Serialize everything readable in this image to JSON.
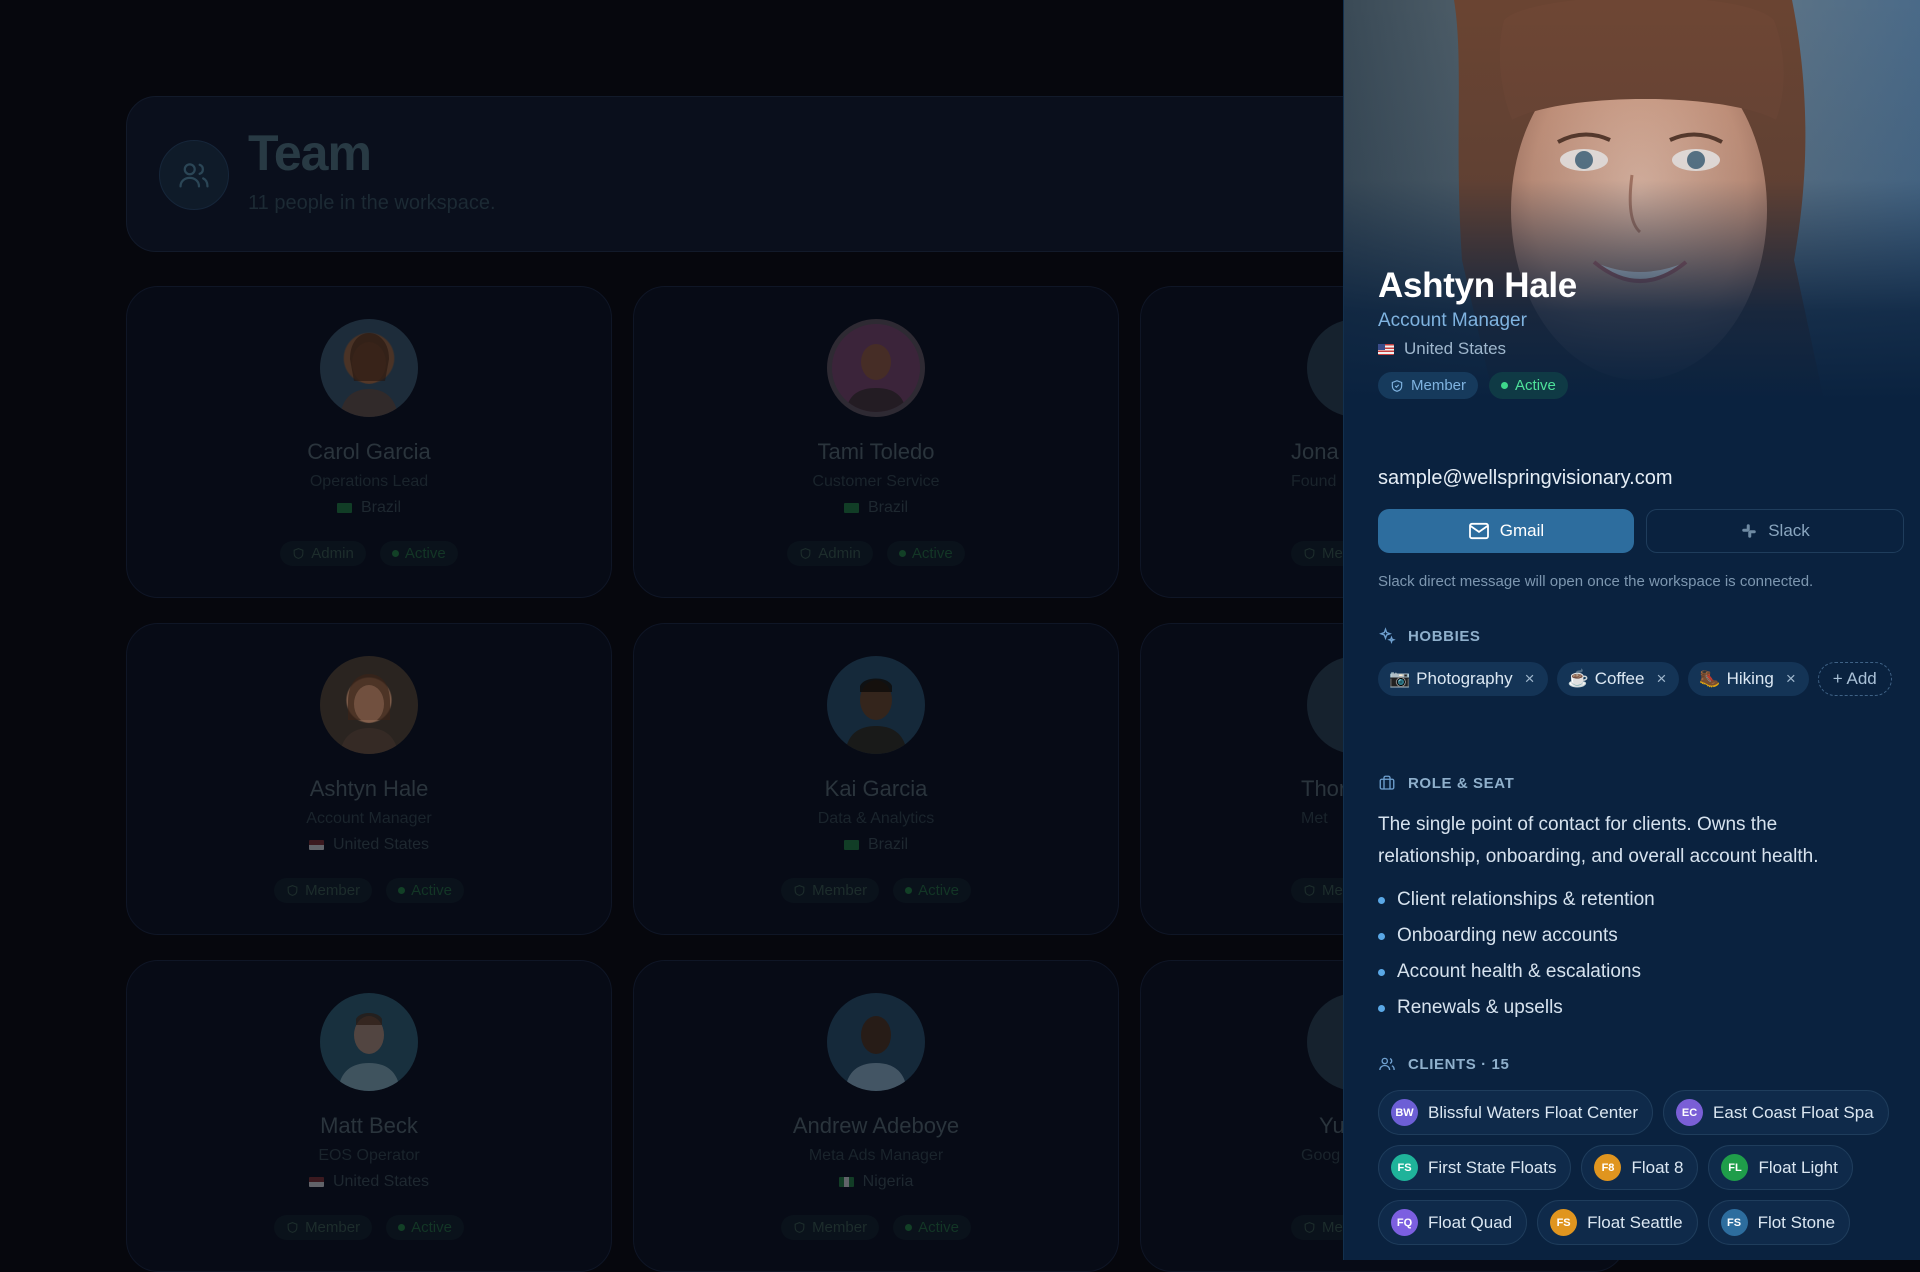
{
  "header": {
    "title": "Team",
    "subtitle": "11 people in the workspace."
  },
  "cards": [
    {
      "name": "Carol Garcia",
      "role": "Operations Lead",
      "country": "Brazil",
      "badge": "Admin",
      "status": "Active"
    },
    {
      "name": "Tami Toledo",
      "role": "Customer Service",
      "country": "Brazil",
      "badge": "Admin",
      "status": "Active"
    },
    {
      "name": "Jona",
      "role": "Found",
      "country": "",
      "badge": "Mer",
      "status": ""
    },
    {
      "name": "Ashtyn Hale",
      "role": "Account Manager",
      "country": "United States",
      "badge": "Member",
      "status": "Active"
    },
    {
      "name": "Kai Garcia",
      "role": "Data & Analytics",
      "country": "Brazil",
      "badge": "Member",
      "status": "Active"
    },
    {
      "name": "Thor",
      "role": "Met",
      "country": "",
      "badge": "Mer",
      "status": ""
    },
    {
      "name": "Matt Beck",
      "role": "EOS Operator",
      "country": "United States",
      "badge": "Member",
      "status": "Active"
    },
    {
      "name": "Andrew Adeboye",
      "role": "Meta Ads Manager",
      "country": "Nigeria",
      "badge": "Member",
      "status": "Active"
    },
    {
      "name": "Yu",
      "role": "Goog",
      "country": "",
      "badge": "Mer",
      "status": ""
    }
  ],
  "profile": {
    "name": "Ashtyn Hale",
    "role": "Account Manager",
    "country": "United States",
    "badge": "Member",
    "status": "Active",
    "email": "sample@wellspringvisionary.com",
    "gmail_label": "Gmail",
    "slack_label": "Slack",
    "slack_hint": "Slack direct message will open once the workspace is connected.",
    "hobbies_title": "HOBBIES",
    "hobbies": [
      {
        "emoji": "📷",
        "label": "Photography"
      },
      {
        "emoji": "☕",
        "label": "Coffee"
      },
      {
        "emoji": "🥾",
        "label": "Hiking"
      }
    ],
    "add_label": "+ Add",
    "role_title": "ROLE & SEAT",
    "role_description": "The single point of contact for clients. Owns the relationship, onboarding, and overall account health.",
    "responsibilities": [
      "Client relationships & retention",
      "Onboarding new accounts",
      "Account health & escalations",
      "Renewals & upsells"
    ],
    "clients_title": "CLIENTS · 15",
    "clients": [
      {
        "initials": "BW",
        "name": "Blissful Waters Float Center",
        "color": "#6d5fd6"
      },
      {
        "initials": "EC",
        "name": "East Coast Float Spa",
        "color": "#7a5fd6"
      },
      {
        "initials": "FS",
        "name": "First State Floats",
        "color": "#1fb39a"
      },
      {
        "initials": "F8",
        "name": "Float 8",
        "color": "#e0951f"
      },
      {
        "initials": "FL",
        "name": "Float Light",
        "color": "#1f9d4a"
      },
      {
        "initials": "FQ",
        "name": "Float Quad",
        "color": "#7c5fe0"
      },
      {
        "initials": "FS",
        "name": "Float Seattle",
        "color": "#e0951f"
      },
      {
        "initials": "FS",
        "name": "Flot Stone",
        "color": "#2d6d9e"
      }
    ]
  },
  "colors": {
    "accent": "#2d6d9e",
    "active": "#3ed68b",
    "drawer_bg": "#0a223f"
  }
}
